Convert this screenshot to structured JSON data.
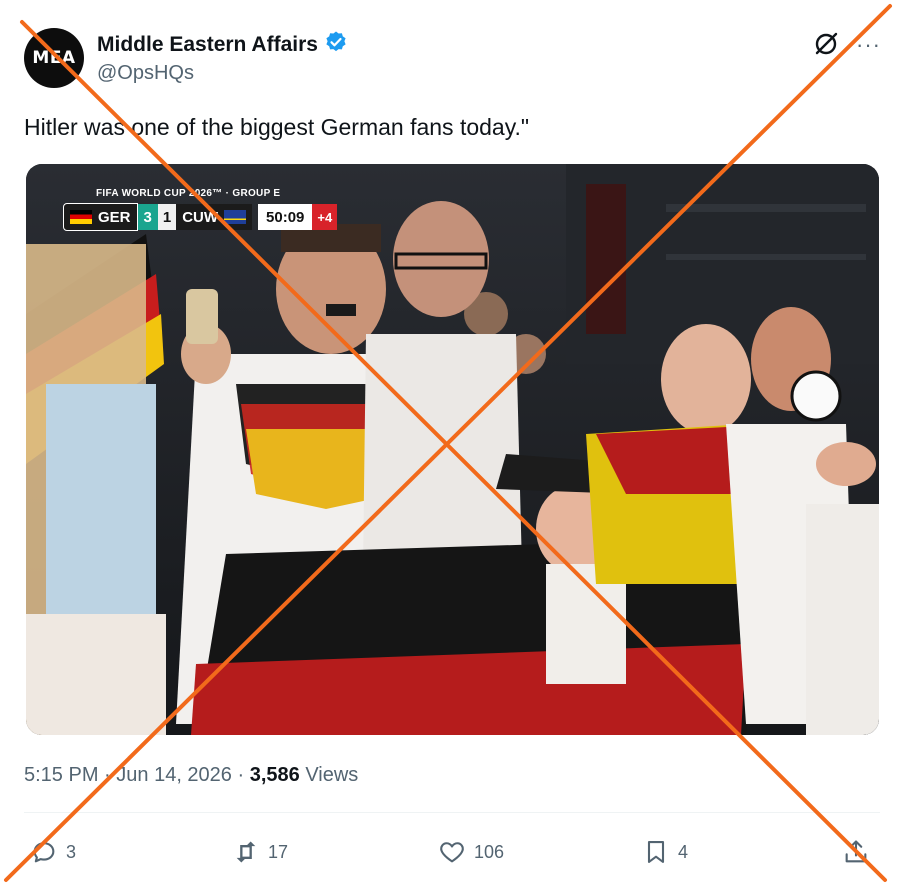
{
  "author": {
    "avatar_text": "MEA",
    "display_name": "Middle Eastern Affairs",
    "handle": "@OpsHQs",
    "verified": true
  },
  "header_icons": [
    "grok-icon",
    "more-icon"
  ],
  "tweet": {
    "text": "Hitler was one of the biggest German fans today.\""
  },
  "media": {
    "scorebug": {
      "title": "FIFA WORLD CUP 2026™ · GROUP E",
      "team_home": "GER",
      "score_home": "3",
      "score_away": "1",
      "team_away": "CUW",
      "clock": "50:09",
      "added_time": "+4"
    }
  },
  "meta": {
    "time": "5:15 PM",
    "separator": " · ",
    "date": "Jun 14, 2026",
    "dot": " · ",
    "views_count": "3,586",
    "views_label": " Views"
  },
  "actions": {
    "replies": "3",
    "reposts": "17",
    "likes": "106",
    "bookmarks": "4"
  },
  "colors": {
    "cross_overlay": "#f26a1b",
    "verified_badge": "#1d9bf0",
    "secondary_text": "#536471"
  }
}
